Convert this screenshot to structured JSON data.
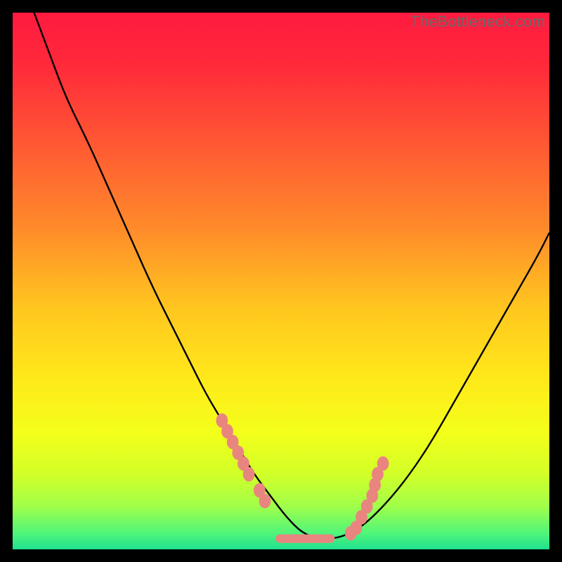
{
  "watermark": "TheBottleneck.com",
  "chart_data": {
    "type": "line",
    "title": "",
    "xlabel": "",
    "ylabel": "",
    "xlim": [
      0,
      100
    ],
    "ylim": [
      0,
      100
    ],
    "grid": false,
    "gradient_stops": [
      {
        "offset": 0.0,
        "color": "#ff1a3f"
      },
      {
        "offset": 0.1,
        "color": "#ff2a3a"
      },
      {
        "offset": 0.25,
        "color": "#ff5a33"
      },
      {
        "offset": 0.4,
        "color": "#ff8a2a"
      },
      {
        "offset": 0.55,
        "color": "#ffc61f"
      },
      {
        "offset": 0.68,
        "color": "#ffe81a"
      },
      {
        "offset": 0.78,
        "color": "#f4ff1a"
      },
      {
        "offset": 0.86,
        "color": "#d2ff28"
      },
      {
        "offset": 0.92,
        "color": "#a0ff4a"
      },
      {
        "offset": 0.97,
        "color": "#50f57a"
      },
      {
        "offset": 1.0,
        "color": "#1fe08f"
      }
    ],
    "series": [
      {
        "name": "bottleneck-curve",
        "color": "#000000",
        "x": [
          4,
          7,
          10,
          14,
          18,
          22,
          26,
          30,
          33,
          36,
          39,
          42,
          45,
          48,
          51,
          54,
          57,
          60,
          63,
          66,
          70,
          74,
          78,
          82,
          86,
          90,
          94,
          98,
          100
        ],
        "y": [
          100,
          92,
          84,
          76,
          67,
          58,
          49,
          41,
          35,
          29,
          24,
          19,
          14,
          10,
          6,
          3,
          2,
          2,
          3,
          5,
          9,
          14,
          20,
          27,
          34,
          41,
          48,
          55,
          59
        ]
      }
    ],
    "markers": {
      "color": "#e9857f",
      "radius_pct": 1.0,
      "left_cluster": [
        [
          39,
          24
        ],
        [
          40,
          22
        ],
        [
          41,
          20
        ],
        [
          42,
          18
        ],
        [
          43,
          16
        ],
        [
          44,
          14
        ],
        [
          46,
          11
        ],
        [
          47,
          9
        ]
      ],
      "right_cluster": [
        [
          63,
          3
        ],
        [
          64,
          4
        ],
        [
          65,
          6
        ],
        [
          66,
          8
        ],
        [
          67,
          10
        ],
        [
          67.5,
          12
        ],
        [
          68,
          14
        ],
        [
          69,
          16
        ]
      ],
      "bottom_bar": {
        "x0": 49,
        "x1": 60,
        "y": 2,
        "thickness_pct": 1.6
      }
    }
  }
}
